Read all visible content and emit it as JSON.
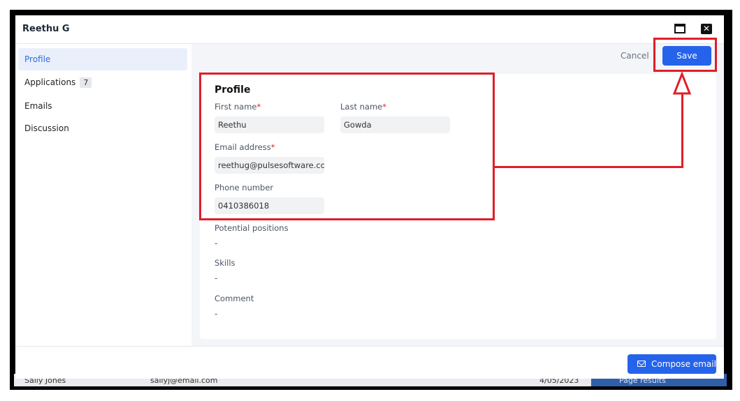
{
  "background_row": {
    "name": "Sally Jones",
    "email": "sallyj@email.com",
    "date": "4/05/2023",
    "button_text": "Page results"
  },
  "modal": {
    "title": "Reethu G"
  },
  "sidebar": {
    "items": [
      {
        "label": "Profile",
        "active": true
      },
      {
        "label": "Applications",
        "badge": "7"
      },
      {
        "label": "Emails"
      },
      {
        "label": "Discussion"
      }
    ]
  },
  "toolbar": {
    "cancel_label": "Cancel",
    "save_label": "Save"
  },
  "profile": {
    "heading": "Profile",
    "first_name": {
      "label": "First name",
      "required": "*",
      "value": "Reethu"
    },
    "last_name": {
      "label": "Last name",
      "required": "*",
      "value": "Gowda"
    },
    "email": {
      "label": "Email address",
      "required": "*",
      "value": "reethug@pulsesoftware.com"
    },
    "phone": {
      "label": "Phone number",
      "value": "0410386018"
    },
    "potential_positions": {
      "label": "Potential positions",
      "value": "-"
    },
    "skills": {
      "label": "Skills",
      "value": "-"
    },
    "comment": {
      "label": "Comment",
      "value": "-"
    }
  },
  "footer": {
    "compose_label": "Compose email"
  },
  "icons": {
    "maximize": "window-maximize-icon",
    "close": "close-icon",
    "mail": "mail-icon"
  },
  "colors": {
    "accent": "#2563eb",
    "highlight": "#e11d2a",
    "active_nav_bg": "#eaf0fb"
  }
}
